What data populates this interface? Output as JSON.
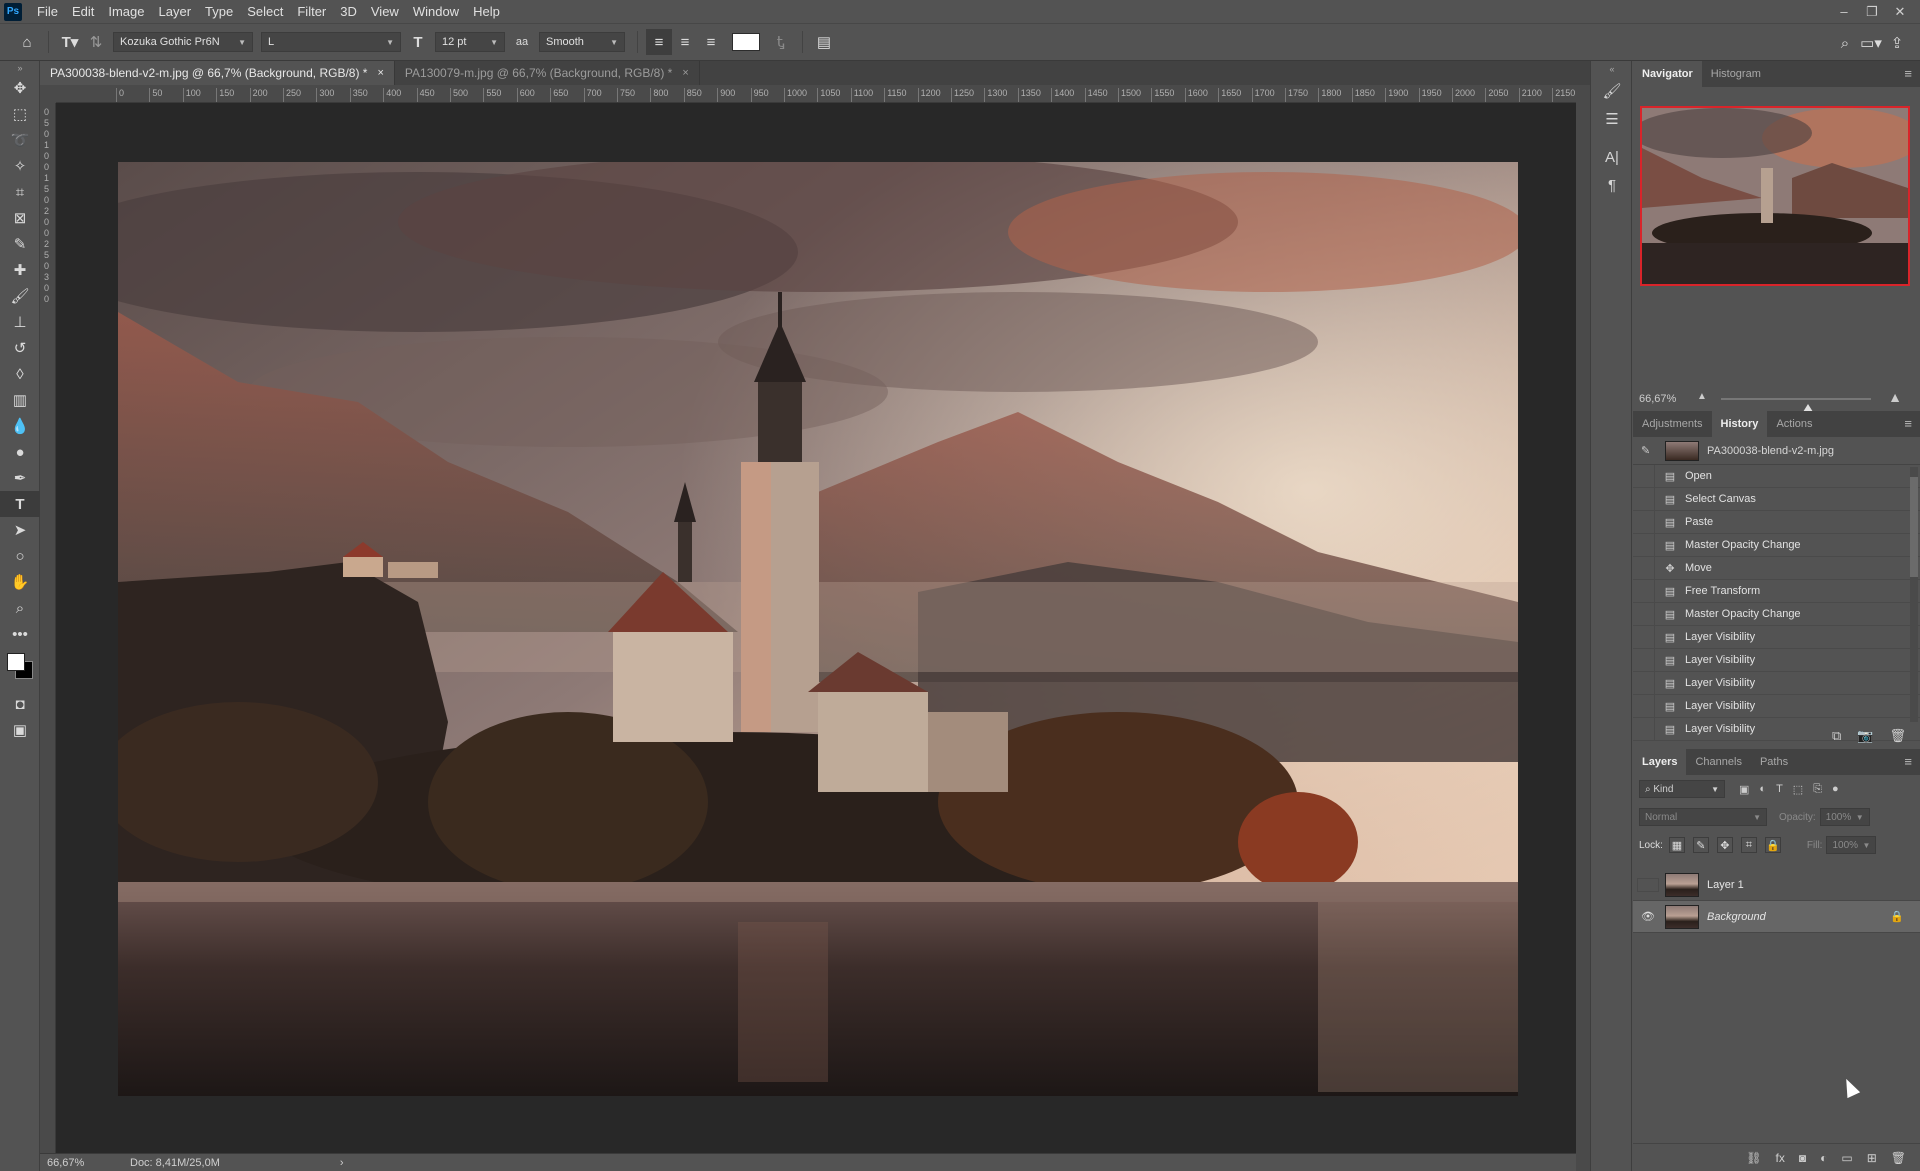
{
  "app": {
    "logo": "Ps"
  },
  "menu": [
    "File",
    "Edit",
    "Image",
    "Layer",
    "Type",
    "Select",
    "Filter",
    "3D",
    "View",
    "Window",
    "Help"
  ],
  "window_controls": {
    "minimize": "–",
    "restore": "❐",
    "close": "✕"
  },
  "options_bar": {
    "font_family": "Kozuka Gothic Pr6N",
    "font_style": "L",
    "font_size": "12 pt",
    "antialias_label": "aa",
    "antialias": "Smooth",
    "text_color": "#ffffff"
  },
  "tabs": [
    {
      "label": "PA300038-blend-v2-m.jpg @ 66,7% (Background, RGB/8) *",
      "close": "×"
    },
    {
      "label": "PA130079-m.jpg @ 66,7% (Background, RGB/8) *",
      "close": "×"
    }
  ],
  "ruler_labels": [
    "0",
    "50",
    "100",
    "150",
    "200",
    "250",
    "300",
    "350",
    "400",
    "450",
    "500",
    "550",
    "600",
    "650",
    "700",
    "750",
    "800",
    "850",
    "900",
    "950",
    "1000",
    "1050",
    "1100",
    "1150",
    "1200",
    "1250",
    "1300",
    "1350",
    "1400",
    "1450",
    "1500",
    "1550",
    "1600",
    "1650",
    "1700",
    "1750",
    "1800",
    "1850",
    "1900",
    "1950",
    "2000",
    "2050",
    "2100",
    "2150"
  ],
  "ruler_v_labels": [
    "0",
    "5",
    "0",
    "1",
    "0",
    "0",
    "1",
    "5",
    "0",
    "2",
    "0",
    "0",
    "2",
    "5",
    "0",
    "3",
    "0",
    "0"
  ],
  "status": {
    "zoom": "66,67%",
    "doc": "Doc: 8,41M/25,0M",
    "arrow": "›"
  },
  "navigator": {
    "tabs": [
      "Navigator",
      "Histogram"
    ],
    "zoom": "66,67%",
    "zoom_level": 0.58
  },
  "history": {
    "tabs": [
      "Adjustments",
      "History",
      "Actions"
    ],
    "snapshot": "PA300038-blend-v2-m.jpg",
    "items": [
      "Open",
      "Select Canvas",
      "Paste",
      "Master Opacity Change",
      "Move",
      "Free Transform",
      "Master Opacity Change",
      "Layer Visibility",
      "Layer Visibility",
      "Layer Visibility",
      "Layer Visibility",
      "Layer Visibility"
    ]
  },
  "layers": {
    "tabs": [
      "Layers",
      "Channels",
      "Paths"
    ],
    "kind": "Kind",
    "blend_mode": "Normal",
    "opacity_label": "Opacity:",
    "opacity": "100%",
    "lock_label": "Lock:",
    "fill_label": "Fill:",
    "fill": "100%",
    "items": [
      {
        "name": "Layer 1",
        "visible": false,
        "selected": false,
        "locked": false
      },
      {
        "name": "Background",
        "visible": true,
        "selected": true,
        "locked": true
      }
    ]
  },
  "colors": {
    "accent": "#31a8ff",
    "panel": "#535353",
    "canvas_bg": "#282828",
    "nav_frame": "#d9242a"
  }
}
